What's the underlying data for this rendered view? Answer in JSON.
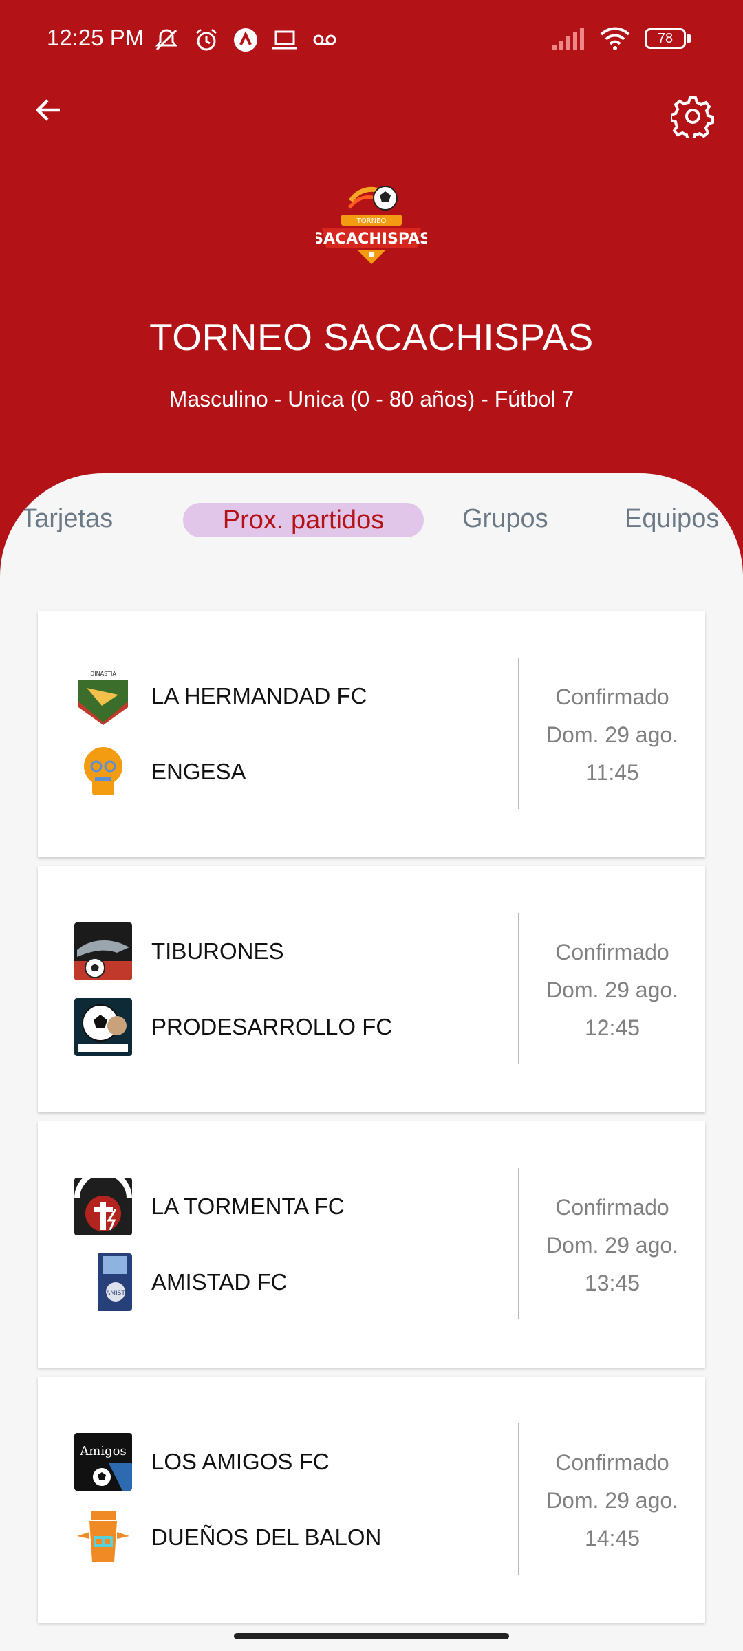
{
  "status_bar": {
    "time": "12:25 PM",
    "battery": "78",
    "left_icons": [
      "mute-icon",
      "alarm-icon",
      "app-icon",
      "laptop-icon",
      "voicemail-icon"
    ],
    "right_icons": [
      "signal-icon",
      "wifi-icon",
      "battery-icon"
    ]
  },
  "header": {
    "title": "TORNEO SACACHISPAS",
    "subtitle": "Masculino - Unica (0 - 80 años) - Fútbol 7",
    "logo_text_top": "TORNEO",
    "logo_text_main": "SACACHISPAS",
    "accent_color": "#b31217"
  },
  "tabs": [
    {
      "label": "es / Tarjetas"
    },
    {
      "label": "Prox. partidos",
      "active": true
    },
    {
      "label": "Grupos"
    },
    {
      "label": "Equipos"
    }
  ],
  "matches": [
    {
      "home": {
        "name": "LA HERMANDAD FC",
        "logo": "la-hermandad-logo"
      },
      "away": {
        "name": "ENGESA",
        "logo": "engesa-logo"
      },
      "status": "Confirmado",
      "date": "Dom. 29 ago.",
      "time": "11:45"
    },
    {
      "home": {
        "name": "TIBURONES",
        "logo": "tiburones-logo"
      },
      "away": {
        "name": "PRODESARROLLO FC",
        "logo": "prodesarrollo-logo"
      },
      "status": "Confirmado",
      "date": "Dom. 29 ago.",
      "time": "12:45"
    },
    {
      "home": {
        "name": "LA TORMENTA FC",
        "logo": "la-tormenta-logo"
      },
      "away": {
        "name": "AMISTAD FC",
        "logo": "amistad-logo"
      },
      "status": "Confirmado",
      "date": "Dom. 29 ago.",
      "time": "13:45"
    },
    {
      "home": {
        "name": "LOS AMIGOS FC",
        "logo": "los-amigos-logo"
      },
      "away": {
        "name": "DUEÑOS DEL BALON",
        "logo": "duenos-del-balon-logo"
      },
      "status": "Confirmado",
      "date": "Dom. 29 ago.",
      "time": "14:45"
    }
  ]
}
